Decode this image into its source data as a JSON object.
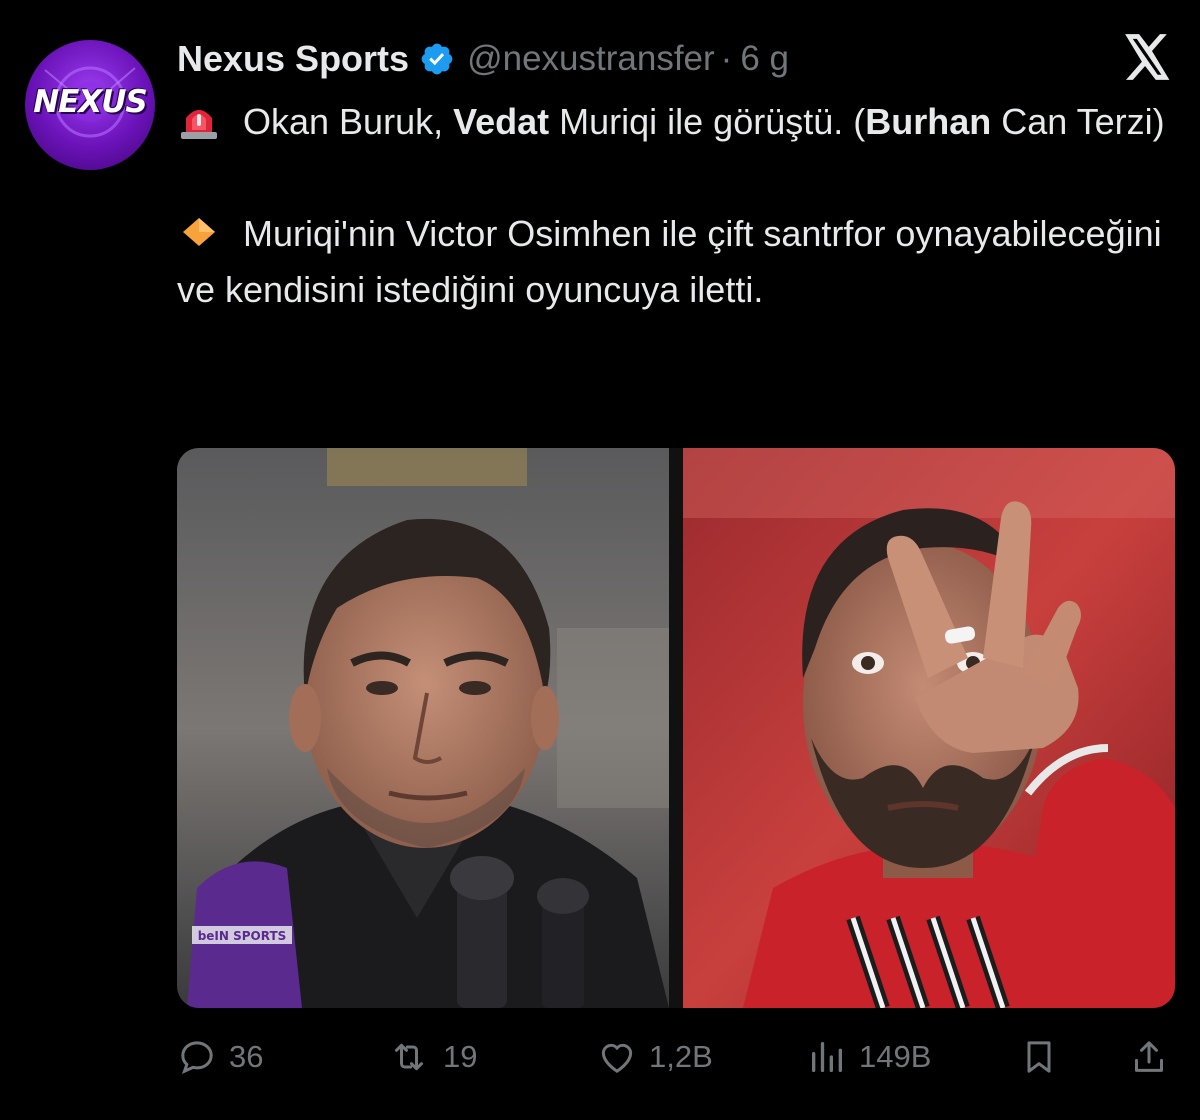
{
  "account": {
    "display_name": "Nexus Sports",
    "handle": "@nexustransfer",
    "separator": "·",
    "time": "6 g",
    "avatar_text": "NEXUS"
  },
  "icons": {
    "verified": "verified-badge-icon",
    "platform": "x-logo-icon",
    "siren": "police-siren-emoji",
    "diamond": "orange-diamond-emoji"
  },
  "tweet": {
    "p1": {
      "t1": "Okan Buruk, ",
      "b1": "Vedat",
      "t2": " Muriqi ile görüştü. (",
      "b2": "Burhan",
      "t3": " Can Terzi)"
    },
    "p2": {
      "t1": "Muriqi'nin Victor Osimhen ile çift santrfor oynayabileceğini ve kendisini istediğini oyuncuya iletti."
    }
  },
  "media": {
    "photo_left_caption": "",
    "mic_brand": "beIN SPORTS"
  },
  "actions": {
    "replies": "36",
    "reposts": "19",
    "likes": "1,2B",
    "views": "149B"
  },
  "colors": {
    "background": "#000000",
    "text": "#e7e9ea",
    "muted": "#71767b",
    "verified": "#1d9bf0",
    "avatar": "#7a1fd0"
  }
}
